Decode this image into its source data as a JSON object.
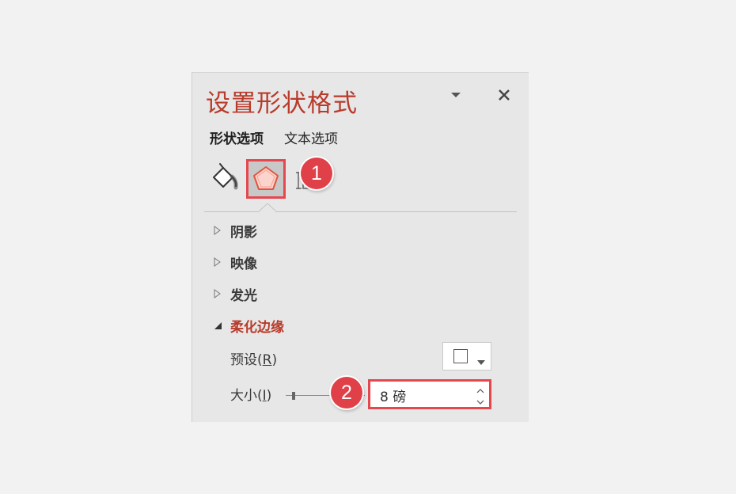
{
  "pane": {
    "title": "设置形状格式",
    "dropdown_icon": "caret-down-icon",
    "close_icon": "close-icon"
  },
  "tabs": [
    {
      "label": "形状选项",
      "active": true
    },
    {
      "label": "文本选项",
      "active": false
    }
  ],
  "icon_tabs": [
    {
      "name": "fill-line-icon",
      "selected": false
    },
    {
      "name": "effects-pentagon-icon",
      "selected": true
    },
    {
      "name": "size-properties-icon",
      "selected": false
    }
  ],
  "sections": [
    {
      "label": "阴影",
      "expanded": false
    },
    {
      "label": "映像",
      "expanded": false
    },
    {
      "label": "发光",
      "expanded": false
    },
    {
      "label": "柔化边缘",
      "expanded": true
    }
  ],
  "soft_edges": {
    "preset_label": "预设(R)",
    "preset_label_text": "预设(",
    "preset_label_key": "R",
    "preset_label_close": ")",
    "size_label_text": "大小(",
    "size_label_key": "I",
    "size_label_close": ")",
    "size_value": "8 磅",
    "size_fraction": 0.08
  },
  "callouts": [
    {
      "number": "1"
    },
    {
      "number": "2"
    }
  ],
  "colors": {
    "accent_title": "#b83b2b",
    "highlight_border": "#e5474f",
    "callout_fill": "#e04048",
    "pentagon_fill": "#fbd5cd",
    "pentagon_stroke": "#e0553f"
  }
}
